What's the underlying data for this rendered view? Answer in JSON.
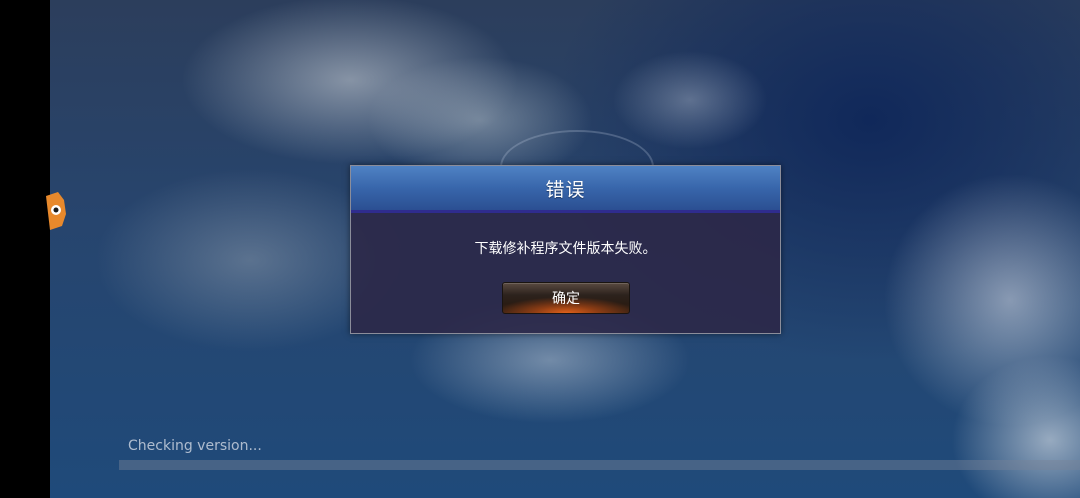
{
  "dialog": {
    "title": "错误",
    "message": "下载修补程序文件版本失败。",
    "confirm_label": "确定"
  },
  "loading": {
    "status_text": "Checking version...",
    "progress": 0
  },
  "icons": {
    "mascot": "cat-mascot-icon"
  },
  "colors": {
    "header_blue": "#3866ab",
    "dialog_body": "#2c2848",
    "button_glow": "#e0601a"
  }
}
